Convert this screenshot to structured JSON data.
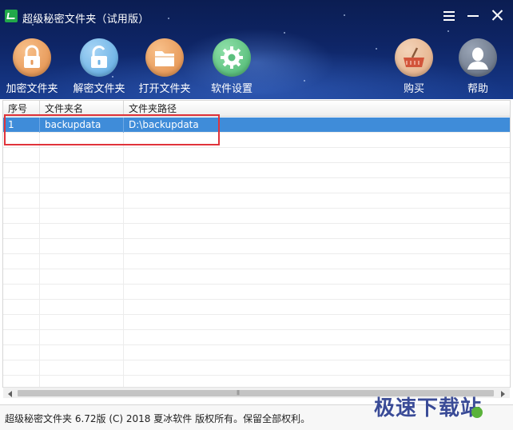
{
  "window": {
    "title": "超级秘密文件夹（试用版）",
    "controls": [
      "menu-icon",
      "minimize-icon",
      "close-icon"
    ]
  },
  "toolbar": {
    "items": [
      {
        "label": "加密文件夹",
        "icon": "lock-icon",
        "color": "#e79a5a"
      },
      {
        "label": "解密文件夹",
        "icon": "unlock-icon",
        "color": "#6fb4e6"
      },
      {
        "label": "打开文件夹",
        "icon": "folder-icon",
        "color": "#e79a5a"
      },
      {
        "label": "软件设置",
        "icon": "gear-icon",
        "color": "#5cc07e"
      },
      {
        "label": "购买",
        "icon": "basket-icon",
        "color": "#e6b590"
      },
      {
        "label": "帮助",
        "icon": "user-icon",
        "color": "#6f7a8c"
      }
    ]
  },
  "table": {
    "columns": [
      "序号",
      "文件夹名",
      "文件夹路径"
    ],
    "rows": [
      {
        "index": "1",
        "name": "backupdata",
        "path": "D:\\backupdata",
        "selected": true
      }
    ],
    "selection_color": "#3f8cd9",
    "highlight_color": "#e0333b"
  },
  "status": {
    "text": "超级秘密文件夹 6.72版 (C) 2018 夏冰软件 版权所有。保留全部权利。"
  },
  "watermark": {
    "text": "极速下载站"
  }
}
